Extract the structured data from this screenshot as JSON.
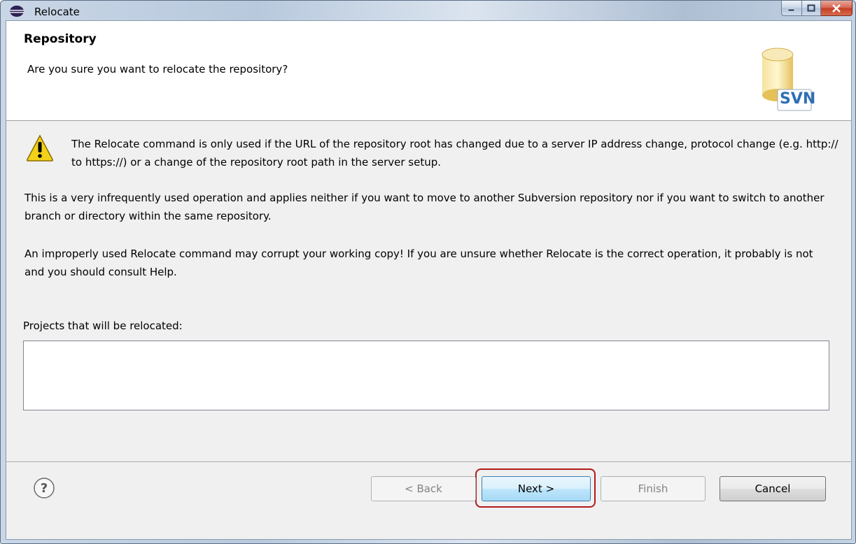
{
  "window": {
    "title": "Relocate",
    "controls": [
      "minimize",
      "maximize",
      "close"
    ]
  },
  "header": {
    "title": "Repository",
    "description": "Are you sure you want to relocate the repository?",
    "logo_text": "SVN"
  },
  "content": {
    "warning_icon": "warning-triangle-icon",
    "paragraphs": [
      "The Relocate command is only used if the URL of the repository root has changed due to a server IP address change, protocol change (e.g. http:// to https://) or a change of the repository root path in the server setup.",
      "This is a very infrequently used operation and applies neither if you want to move to another Subversion repository nor if you want to switch to another branch or directory within the same repository.",
      "An improperly used Relocate command may corrupt your working copy!  If you are unsure whether Relocate is the correct operation, it probably is not and you should consult Help."
    ],
    "projects_label": "Projects that will be relocated:",
    "projects": []
  },
  "footer": {
    "help_icon": "help-icon",
    "buttons": {
      "back": "< Back",
      "next": "Next >",
      "finish": "Finish",
      "cancel": "Cancel"
    }
  },
  "colors": {
    "highlight": "#b01a1a",
    "svn_logo": "#2f6fb3",
    "warning": "#f2d11b"
  }
}
